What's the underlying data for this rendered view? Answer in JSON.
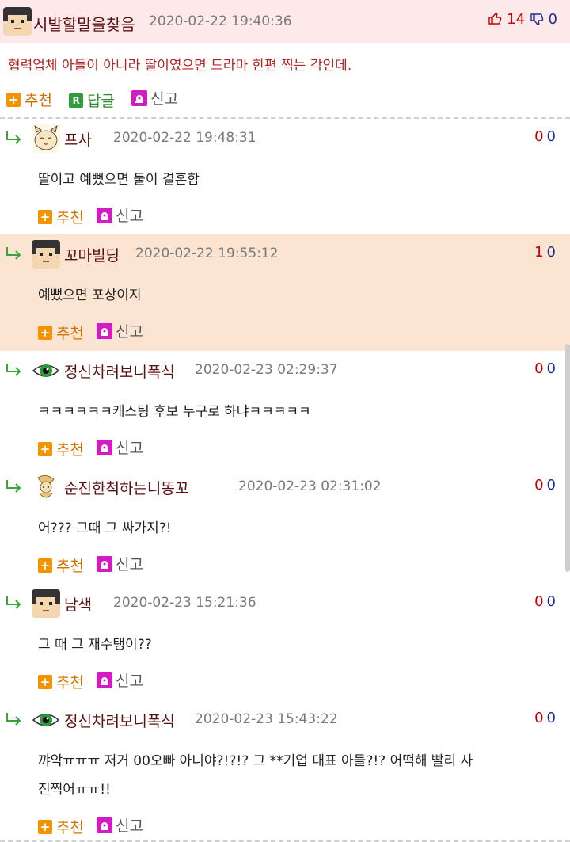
{
  "colors": {
    "main_bg": "#fde8ea",
    "highlight_bg": "#fbe5d2",
    "recommend": "#d07000",
    "report_icon": "#d21bc0",
    "up_vote": "#c00000",
    "down_vote": "#1d2f8e"
  },
  "main_comment": {
    "author": "시발할말을찾음",
    "date": "2020-02-22 19:40:36",
    "up": "14",
    "down": "0",
    "text": "협력업체 아들이 아니라 딸이였으면 드라마 한편 찍는 각인데.",
    "actions": {
      "recommend": "추천",
      "reply": "답글",
      "report": "신고"
    }
  },
  "replies": [
    {
      "author": "프사",
      "date": "2020-02-22 19:48:31",
      "up": "0",
      "down": "0",
      "lines": [
        "딸이고 예뻤으면 둘이 결혼함"
      ],
      "avatar": "cat-avatar-icon"
    },
    {
      "author": "꼬마빌딩",
      "date": "2020-02-22 19:55:12",
      "up": "1",
      "down": "0",
      "lines": [
        "예뻤으면 포상이지"
      ],
      "avatar": "pixel-face-avatar-icon"
    },
    {
      "author": "정신차려보니폭식",
      "date": "2020-02-23 02:29:37",
      "up": "0",
      "down": "0",
      "lines": [
        "ㅋㅋㅋㅋㅋㅋ캐스팅 후보 누구로 하냐ㅋㅋㅋㅋㅋ"
      ],
      "avatar": "eye-avatar-icon"
    },
    {
      "author": "순진한척하는니똥꼬",
      "date": "2020-02-23 02:31:02",
      "up": "0",
      "down": "0",
      "lines": [
        "어??? 그때 그 싸가지?!"
      ],
      "avatar": "doodle-avatar-icon"
    },
    {
      "author": "남색",
      "date": "2020-02-23 15:21:36",
      "up": "0",
      "down": "0",
      "lines": [
        "그 때 그 재수탱이??"
      ],
      "avatar": "pixel-face-avatar-icon"
    },
    {
      "author": "정신차려보니폭식",
      "date": "2020-02-23 15:43:22",
      "up": "0",
      "down": "0",
      "lines": [
        "꺄악ㅠㅠㅠ 저거 00오빠 아니야?!?!? 그 **기업 대표 아들?!? 어떡해 빨리 사",
        "진찍어ㅠㅠ!!"
      ],
      "avatar": "eye-avatar-icon"
    }
  ],
  "reply_actions": {
    "recommend": "추천",
    "report": "신고"
  }
}
